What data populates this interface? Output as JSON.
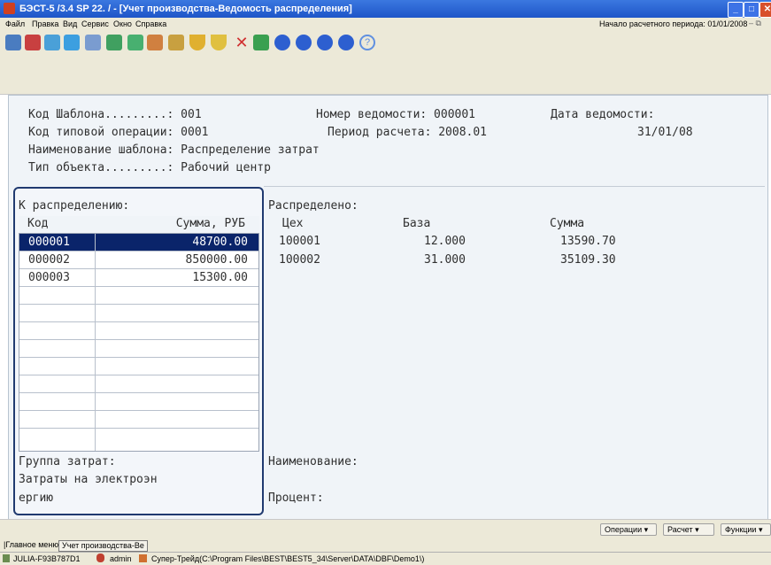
{
  "window": {
    "title": "БЭСТ-5 /3.4 SP 22. / - [Учет производства-Ведомость распределения]"
  },
  "menu": [
    "Файл",
    "Правка",
    "Вид",
    "Сервис",
    "Окно",
    "Справка"
  ],
  "period": {
    "label": "Начало расчетного периода: 01/01/2008"
  },
  "toolbar_icons": [
    "exit-icon",
    "document-icon",
    "record-icon",
    "copy-icon",
    "edit-icon",
    "grid-icon",
    "table-icon",
    "move-icon",
    "move-alt-icon",
    "filter-icon",
    "filter-clear-icon",
    "delete-icon",
    "chart-icon",
    "first-icon",
    "prev-icon",
    "next-icon",
    "last-icon",
    "help-icon"
  ],
  "header": {
    "line1_left": "Код Шаблона.........: 001",
    "line1_mid": "Номер ведомости: 000001",
    "line1_right": "Дата ведомости:",
    "line2_left": "Код типовой операции: 0001",
    "line2_mid": "Период расчета: 2008.01",
    "line2_right": "31/01/08",
    "line3": "Наименование шаблона: Распределение затрат",
    "line4": "Тип объекта.........: Рабочий центр"
  },
  "left": {
    "title": "К распределению:",
    "col_code": "Код",
    "col_sum": "Сумма, РУБ",
    "rows": [
      {
        "code": "000001",
        "sum": "48700.00"
      },
      {
        "code": "000002",
        "sum": "850000.00"
      },
      {
        "code": "000003",
        "sum": "15300.00"
      }
    ],
    "group_label": "Группа затрат:",
    "group_value1": "Затраты на электроэн",
    "group_value2": "ергию"
  },
  "right": {
    "title": "Распределено:",
    "col_shop": "Цех",
    "col_base": "База",
    "col_sum": "Сумма",
    "rows": [
      {
        "shop": "100001",
        "base": "12.000",
        "sum": "13590.70"
      },
      {
        "shop": "100002",
        "base": "31.000",
        "sum": "35109.30"
      }
    ],
    "name_label": "Наименование:",
    "percent_label": "Процент:"
  },
  "funcbar": {
    "operations": "Операции",
    "calc": "Расчет",
    "functions": "Функции"
  },
  "tabs": [
    "|Главное меню|",
    "Учет производства-Ве"
  ],
  "status": {
    "computer": "JULIA-F93B787D1",
    "user": "admin",
    "path": "Супер-Трейд(C:\\Program Files\\BEST\\BEST5_34\\Server\\DATA\\DBF\\Demo1\\)"
  },
  "colors": {
    "selection": "#0a246a",
    "panel_border": "#203a70",
    "titlebar": "#1e55c8"
  }
}
